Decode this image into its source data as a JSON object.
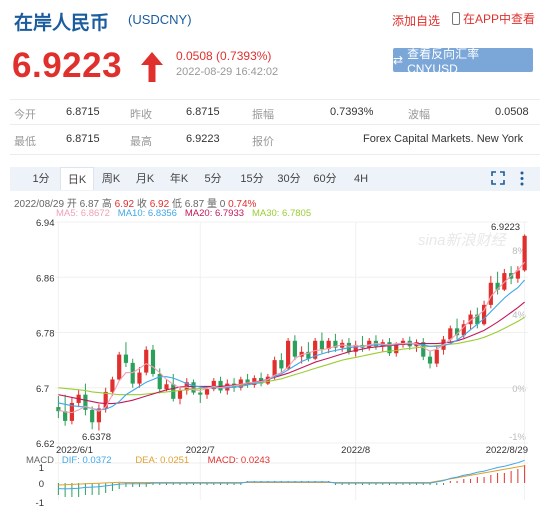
{
  "header": {
    "title": "在岸人民币",
    "code": "(USDCNY)",
    "add_watchlist": "添加自选",
    "app_view": "在APP中查看"
  },
  "quote": {
    "price": "6.9223",
    "change": "0.0508 (0.7393%)",
    "time": "2022-08-29 16:42:02",
    "invert_button": "查看反向汇率 CNYUSD"
  },
  "stats": {
    "open_label": "今开",
    "open": "6.8715",
    "prev_label": "昨收",
    "prev": "6.8715",
    "amp_label": "振幅",
    "amp": "0.7393%",
    "wave_label": "波幅",
    "wave": "0.0508",
    "low_label": "最低",
    "low": "6.8715",
    "high_label": "最高",
    "high": "6.9223",
    "quote_label": "报价",
    "quote_src": "Forex Capital Markets. New York"
  },
  "tabs": [
    "1分",
    "日K",
    "周K",
    "月K",
    "年K",
    "5分",
    "15分",
    "30分",
    "60分",
    "4H"
  ],
  "active_tab": "日K",
  "chart_info": {
    "date_label": "2022/08/29",
    "open_label": "开",
    "open": "6.87",
    "high_label": "高",
    "high": "6.92",
    "close_label": "收",
    "close": "6.92",
    "low_label": "低",
    "low": "6.87",
    "amount_label": "量",
    "amount": "0",
    "pct": "0.74%",
    "ma5": "MA5: 6.8672",
    "ma10": "MA10: 6.8356",
    "ma20": "MA20: 6.7933",
    "ma30": "MA30: 6.7805"
  },
  "macd_info": {
    "macd": "MACD",
    "dif": "DIF: 0.0372",
    "dea": "DEA: 0.0251",
    "value": "MACD: 0.0243"
  },
  "watermark": "sina新浪财经",
  "colors": {
    "up": "#e0302d",
    "down": "#2aa05a",
    "ma5": "#f0a0b4",
    "ma10": "#3fa7ea",
    "ma20": "#c2185b",
    "ma30": "#9acd32",
    "accent": "#1a5c9e"
  },
  "chart_data": {
    "type": "candlestick",
    "y_ticks": [
      "6.94",
      "6.86",
      "6.78",
      "6.7",
      "6.62"
    ],
    "pct_ticks": [
      "8%",
      "4%",
      "0%",
      "-1%"
    ],
    "x_ticks": [
      "2022/6/1",
      "2022/7",
      "2022/8",
      "2022/8/29"
    ],
    "ylim": [
      6.62,
      6.94
    ],
    "max_label": "6.9223",
    "min_label": "6.6378",
    "candles": [
      [
        6.672,
        6.688,
        6.656,
        6.666
      ],
      [
        6.666,
        6.69,
        6.645,
        6.652
      ],
      [
        6.652,
        6.685,
        6.647,
        6.678
      ],
      [
        6.678,
        6.697,
        6.672,
        6.69
      ],
      [
        6.69,
        6.706,
        6.66,
        6.668
      ],
      [
        6.668,
        6.673,
        6.64,
        6.65
      ],
      [
        6.65,
        6.676,
        6.638,
        6.67
      ],
      [
        6.67,
        6.7,
        6.664,
        6.694
      ],
      [
        6.694,
        6.716,
        6.688,
        6.712
      ],
      [
        6.712,
        6.752,
        6.71,
        6.748
      ],
      [
        6.748,
        6.766,
        6.73,
        6.736
      ],
      [
        6.736,
        6.742,
        6.7,
        6.706
      ],
      [
        6.706,
        6.73,
        6.7,
        6.722
      ],
      [
        6.722,
        6.76,
        6.718,
        6.755
      ],
      [
        6.755,
        6.762,
        6.716,
        6.72
      ],
      [
        6.72,
        6.728,
        6.692,
        6.698
      ],
      [
        6.698,
        6.712,
        6.695,
        6.705
      ],
      [
        6.705,
        6.72,
        6.68,
        6.684
      ],
      [
        6.684,
        6.7,
        6.676,
        6.696
      ],
      [
        6.696,
        6.714,
        6.69,
        6.708
      ],
      [
        6.708,
        6.712,
        6.69,
        6.693
      ],
      [
        6.693,
        6.7,
        6.678,
        6.69
      ],
      [
        6.69,
        6.702,
        6.684,
        6.698
      ],
      [
        6.698,
        6.714,
        6.695,
        6.71
      ],
      [
        6.71,
        6.716,
        6.692,
        6.696
      ],
      [
        6.696,
        6.712,
        6.69,
        6.706
      ],
      [
        6.706,
        6.714,
        6.694,
        6.7
      ],
      [
        6.7,
        6.716,
        6.696,
        6.712
      ],
      [
        6.712,
        6.72,
        6.7,
        6.704
      ],
      [
        6.704,
        6.718,
        6.7,
        6.714
      ],
      [
        6.714,
        6.722,
        6.702,
        6.706
      ],
      [
        6.706,
        6.72,
        6.704,
        6.716
      ],
      [
        6.716,
        6.745,
        6.712,
        6.74
      ],
      [
        6.74,
        6.75,
        6.722,
        6.728
      ],
      [
        6.728,
        6.772,
        6.725,
        6.768
      ],
      [
        6.768,
        6.776,
        6.74,
        6.745
      ],
      [
        6.745,
        6.76,
        6.735,
        6.752
      ],
      [
        6.752,
        6.766,
        6.738,
        6.742
      ],
      [
        6.742,
        6.772,
        6.74,
        6.768
      ],
      [
        6.768,
        6.78,
        6.75,
        6.756
      ],
      [
        6.756,
        6.772,
        6.75,
        6.768
      ],
      [
        6.768,
        6.778,
        6.752,
        6.758
      ],
      [
        6.758,
        6.77,
        6.752,
        6.765
      ],
      [
        6.765,
        6.772,
        6.748,
        6.752
      ],
      [
        6.752,
        6.768,
        6.745,
        6.762
      ],
      [
        6.762,
        6.775,
        6.752,
        6.758
      ],
      [
        6.758,
        6.772,
        6.754,
        6.768
      ],
      [
        6.768,
        6.776,
        6.755,
        6.76
      ],
      [
        6.76,
        6.77,
        6.752,
        6.766
      ],
      [
        6.766,
        6.772,
        6.746,
        6.75
      ],
      [
        6.75,
        6.766,
        6.745,
        6.762
      ],
      [
        6.762,
        6.772,
        6.758,
        6.768
      ],
      [
        6.768,
        6.774,
        6.755,
        6.76
      ],
      [
        6.76,
        6.77,
        6.752,
        6.766
      ],
      [
        6.766,
        6.772,
        6.74,
        6.745
      ],
      [
        6.745,
        6.754,
        6.728,
        6.735
      ],
      [
        6.735,
        6.76,
        6.73,
        6.755
      ],
      [
        6.755,
        6.775,
        6.748,
        6.77
      ],
      [
        6.77,
        6.79,
        6.765,
        6.786
      ],
      [
        6.786,
        6.8,
        6.77,
        6.776
      ],
      [
        6.776,
        6.798,
        6.772,
        6.792
      ],
      [
        6.792,
        6.812,
        6.785,
        6.806
      ],
      [
        6.806,
        6.816,
        6.786,
        6.792
      ],
      [
        6.792,
        6.826,
        6.79,
        6.82
      ],
      [
        6.82,
        6.862,
        6.815,
        6.852
      ],
      [
        6.852,
        6.868,
        6.835,
        6.842
      ],
      [
        6.842,
        6.872,
        6.84,
        6.866
      ],
      [
        6.866,
        6.876,
        6.85,
        6.858
      ],
      [
        6.858,
        6.876,
        6.852,
        6.87
      ],
      [
        6.87,
        6.922,
        6.868,
        6.92
      ]
    ],
    "ma5_series": [
      6.668,
      6.665,
      6.664,
      6.668,
      6.673,
      6.67,
      6.666,
      6.672,
      6.69,
      6.71,
      6.722,
      6.722,
      6.728,
      6.735,
      6.73,
      6.722,
      6.712,
      6.705,
      6.7,
      6.701,
      6.697,
      6.696,
      6.699,
      6.702,
      6.7,
      6.702,
      6.703,
      6.705,
      6.707,
      6.708,
      6.709,
      6.712,
      6.718,
      6.722,
      6.73,
      6.742,
      6.748,
      6.75,
      6.754,
      6.755,
      6.757,
      6.76,
      6.762,
      6.76,
      6.761,
      6.76,
      6.762,
      6.764,
      6.763,
      6.762,
      6.764,
      6.764,
      6.765,
      6.764,
      6.758,
      6.753,
      6.756,
      6.762,
      6.77,
      6.778,
      6.788,
      6.798,
      6.804,
      6.812,
      6.832,
      6.843,
      6.853,
      6.862,
      6.87,
      6.882
    ],
    "ma10_series": [
      6.678,
      6.676,
      6.674,
      6.673,
      6.672,
      6.67,
      6.668,
      6.669,
      6.673,
      6.68,
      6.69,
      6.696,
      6.702,
      6.708,
      6.712,
      6.716,
      6.716,
      6.714,
      6.71,
      6.706,
      6.703,
      6.701,
      6.7,
      6.7,
      6.7,
      6.7,
      6.701,
      6.702,
      6.704,
      6.706,
      6.708,
      6.712,
      6.716,
      6.72,
      6.726,
      6.732,
      6.738,
      6.742,
      6.746,
      6.749,
      6.752,
      6.754,
      6.756,
      6.758,
      6.759,
      6.76,
      6.761,
      6.762,
      6.762,
      6.762,
      6.763,
      6.764,
      6.764,
      6.763,
      6.762,
      6.76,
      6.76,
      6.761,
      6.764,
      6.769,
      6.776,
      6.784,
      6.792,
      6.8,
      6.81,
      6.82,
      6.83,
      6.838,
      6.845,
      6.856
    ],
    "ma20_series": [
      6.69,
      6.688,
      6.686,
      6.684,
      6.682,
      6.68,
      6.678,
      6.677,
      6.677,
      6.678,
      6.68,
      6.682,
      6.685,
      6.688,
      6.691,
      6.694,
      6.697,
      6.699,
      6.701,
      6.702,
      6.702,
      6.702,
      6.702,
      6.702,
      6.702,
      6.703,
      6.704,
      6.705,
      6.706,
      6.708,
      6.71,
      6.712,
      6.715,
      6.718,
      6.721,
      6.725,
      6.729,
      6.733,
      6.737,
      6.74,
      6.743,
      6.746,
      6.749,
      6.752,
      6.754,
      6.756,
      6.758,
      6.759,
      6.76,
      6.761,
      6.762,
      6.763,
      6.763,
      6.764,
      6.764,
      6.764,
      6.764,
      6.765,
      6.766,
      6.768,
      6.771,
      6.775,
      6.779,
      6.783,
      6.789,
      6.795,
      6.802,
      6.809,
      6.816,
      6.824
    ],
    "ma30_series": [
      6.7,
      6.699,
      6.698,
      6.697,
      6.696,
      6.694,
      6.693,
      6.692,
      6.691,
      6.69,
      6.69,
      6.69,
      6.69,
      6.691,
      6.692,
      6.693,
      6.694,
      6.695,
      6.696,
      6.697,
      6.698,
      6.699,
      6.7,
      6.7,
      6.701,
      6.702,
      6.703,
      6.704,
      6.705,
      6.706,
      6.707,
      6.709,
      6.711,
      6.713,
      6.716,
      6.719,
      6.722,
      6.725,
      6.728,
      6.731,
      6.734,
      6.737,
      6.74,
      6.742,
      6.744,
      6.746,
      6.748,
      6.75,
      6.752,
      6.753,
      6.754,
      6.756,
      6.757,
      6.758,
      6.759,
      6.76,
      6.761,
      6.762,
      6.763,
      6.764,
      6.766,
      6.768,
      6.77,
      6.773,
      6.777,
      6.781,
      6.786,
      6.791,
      6.796,
      6.802
    ],
    "macd_hist": [
      -0.006,
      -0.007,
      -0.007,
      -0.007,
      -0.006,
      -0.006,
      -0.006,
      -0.005,
      -0.004,
      -0.003,
      -0.002,
      -0.002,
      -0.002,
      -0.002,
      -0.001,
      -0.001,
      -0.001,
      -0.001,
      -0.001,
      -0.001,
      -0.001,
      -0.001,
      -0.001,
      -0.001,
      -0.001,
      -0.001,
      -0.001,
      -0.001,
      0.001,
      0.001,
      0.001,
      0.001,
      0.001,
      0.001,
      0.001,
      0.001,
      0.001,
      0.001,
      0.001,
      0.001,
      0.001,
      -0.001,
      -0.001,
      -0.001,
      -0.001,
      -0.001,
      -0.001,
      -0.001,
      -0.001,
      -0.001,
      -0.001,
      -0.001,
      -0.001,
      -0.001,
      -0.001,
      -0.001,
      -0.001,
      -0.001,
      0.001,
      0.001,
      0.002,
      0.002,
      0.003,
      0.003,
      0.004,
      0.005,
      0.005,
      0.006,
      0.007,
      0.009
    ],
    "macd_ticks": [
      "1",
      "0",
      "-1"
    ]
  }
}
